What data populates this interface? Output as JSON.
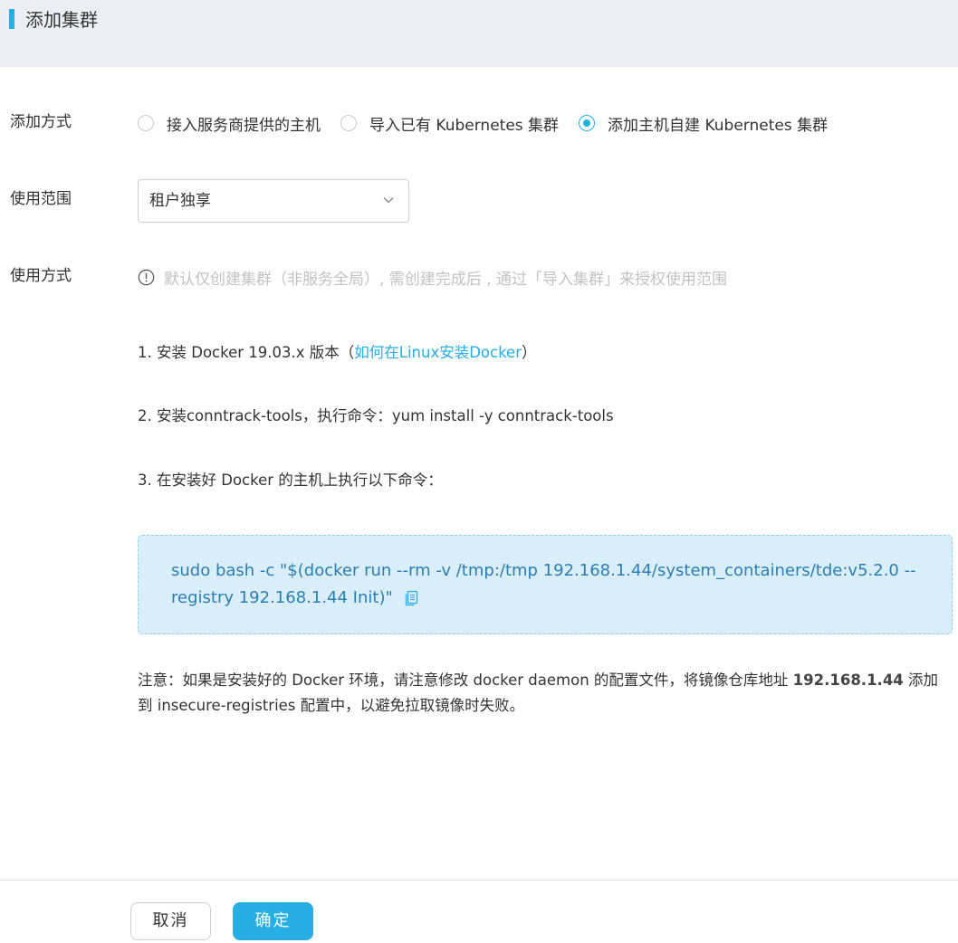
{
  "header": {
    "title": "添加集群"
  },
  "form": {
    "add_method": {
      "label": "添加方式",
      "options": [
        {
          "label": "接入服务商提供的主机",
          "checked": false
        },
        {
          "label": "导入已有 Kubernetes 集群",
          "checked": false
        },
        {
          "label": "添加主机自建 Kubernetes 集群",
          "checked": true
        }
      ]
    },
    "scope": {
      "label": "使用范围",
      "value": "租户独享"
    },
    "usage": {
      "label": "使用方式",
      "info": "默认仅创建集群（非服务全局）, 需创建完成后 , 通过「导入集群」来授权使用范围"
    }
  },
  "steps": {
    "step1_prefix": "1. 安装 Docker 19.03.x 版本（",
    "step1_link": "如何在Linux安装Docker",
    "step1_suffix": "）",
    "step2": "2. 安装conntrack-tools，执行命令：yum install -y conntrack-tools",
    "step3": "3. 在安装好 Docker 的主机上执行以下命令："
  },
  "command": {
    "text": "sudo bash -c \"$(docker run --rm -v /tmp:/tmp 192.168.1.44/system_containers/tde:v5.2.0 --registry 192.168.1.44 Init)\""
  },
  "note": {
    "prefix": "注意：如果是安装好的 Docker 环境，请注意修改 docker daemon 的配置文件，将镜像仓库地址 ",
    "registry": "192.168.1.44",
    "suffix": " 添加到 insecure-registries 配置中，以避免拉取镜像时失败。"
  },
  "footer": {
    "cancel_label": "取消",
    "ok_label": "确定"
  },
  "colors": {
    "accent": "#27aee4",
    "header_bg": "#eceef3",
    "code_bg": "#d9eef8",
    "code_text": "#2a7fb3"
  },
  "icons": {
    "info": "info-circle-icon",
    "chevron": "chevron-down-icon",
    "copy": "copy-icon"
  }
}
